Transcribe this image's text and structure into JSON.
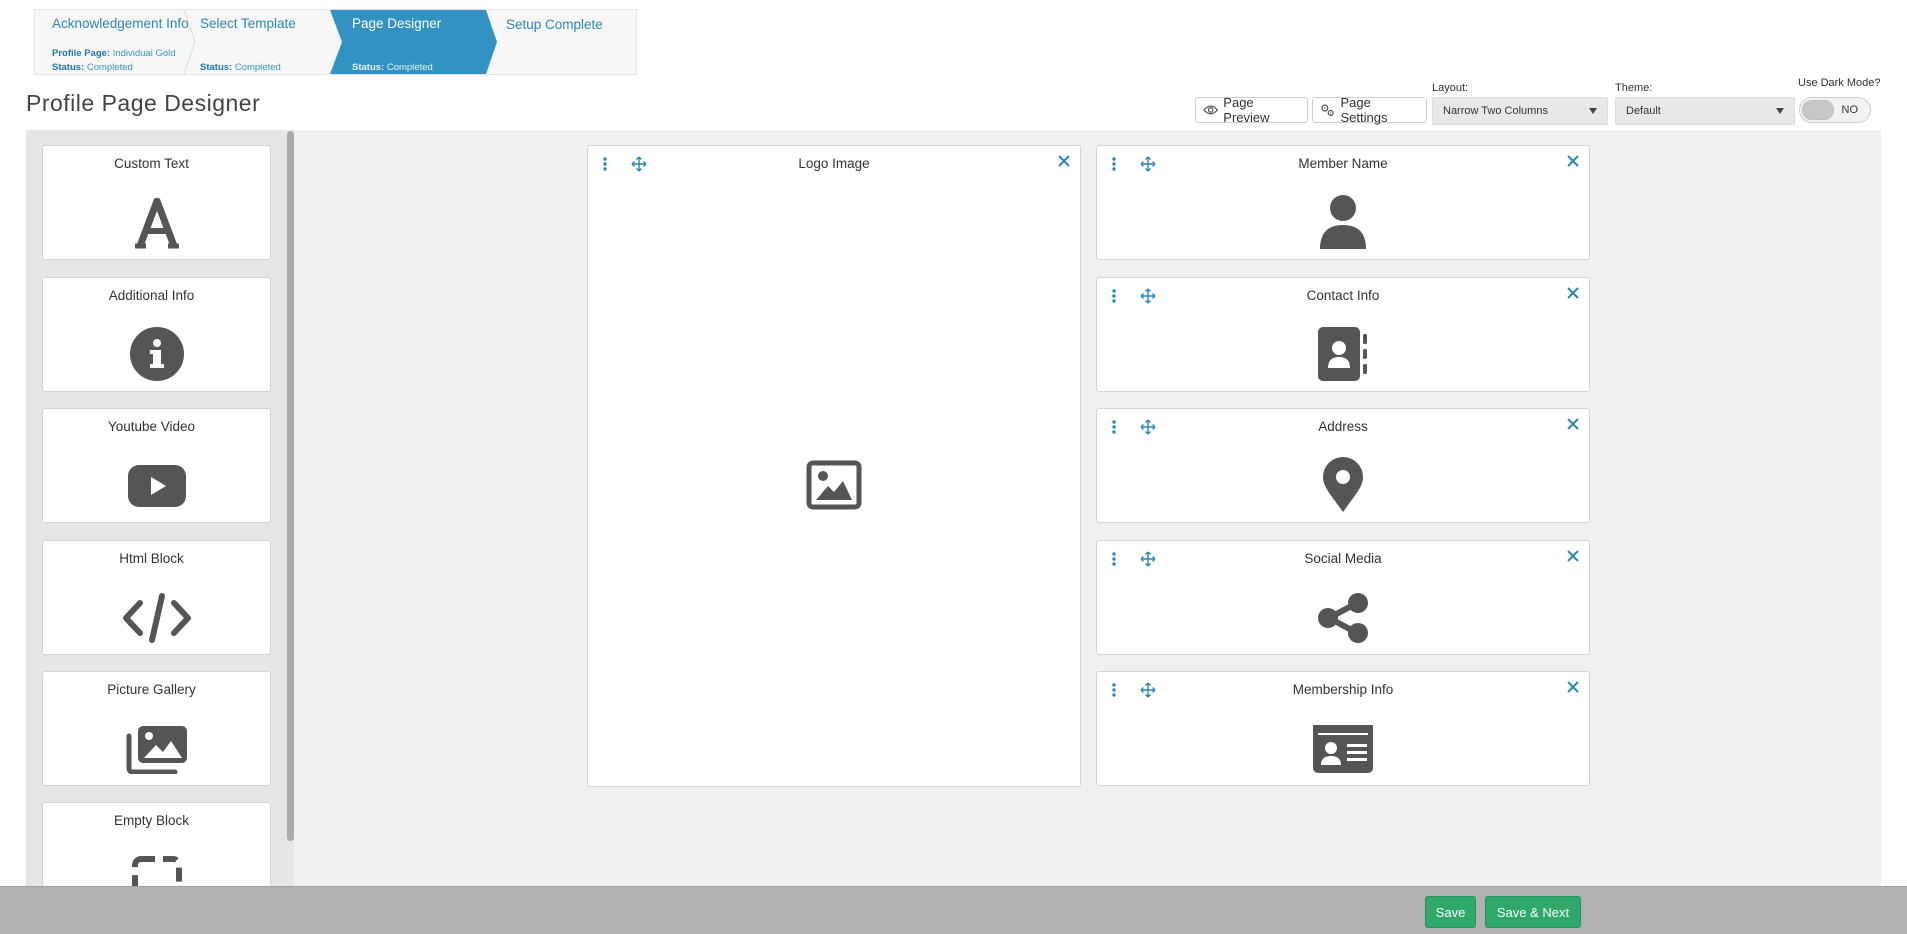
{
  "wizard": {
    "steps": [
      {
        "title": "Acknowledgement Info",
        "meta": [
          {
            "k": "Profile Page:",
            "v": "Individual Gold"
          },
          {
            "k": "Status:",
            "v": "Completed"
          }
        ]
      },
      {
        "title": "Select Template",
        "meta": [
          {
            "k": "Status:",
            "v": "Completed"
          }
        ]
      },
      {
        "title": "Page Designer",
        "meta": [
          {
            "k": "Status:",
            "v": "Completed"
          }
        ]
      },
      {
        "title": "Setup Complete",
        "meta": []
      }
    ],
    "active_step": "Page Designer"
  },
  "header": {
    "title": "Profile Page Designer",
    "page_preview": "Page Preview",
    "page_settings": "Page Settings",
    "layout_label": "Layout:",
    "layout_value": "Narrow Two Columns",
    "theme_label": "Theme:",
    "theme_value": "Default",
    "dark_mode_label": "Use Dark Mode?",
    "dark_mode_value": "NO"
  },
  "palette": {
    "items": [
      {
        "label": "Custom Text",
        "icon": "letter-a-icon"
      },
      {
        "label": "Additional Info",
        "icon": "info-circle-icon"
      },
      {
        "label": "Youtube Video",
        "icon": "youtube-icon"
      },
      {
        "label": "Html Block",
        "icon": "code-icon"
      },
      {
        "label": "Picture Gallery",
        "icon": "images-icon"
      },
      {
        "label": "Empty Block",
        "icon": "dashed-square-icon"
      }
    ]
  },
  "layout": {
    "left_column": [
      {
        "label": "Logo Image",
        "icon": "image-icon"
      }
    ],
    "right_column": [
      {
        "label": "Member Name",
        "icon": "user-icon"
      },
      {
        "label": "Contact Info",
        "icon": "address-book-icon"
      },
      {
        "label": "Address",
        "icon": "map-marker-icon"
      },
      {
        "label": "Social Media",
        "icon": "share-icon"
      },
      {
        "label": "Membership Info",
        "icon": "id-card-icon"
      }
    ]
  },
  "footer": {
    "save": "Save",
    "save_next": "Save & Next"
  },
  "colors": {
    "accent": "#2a88b8",
    "active_step": "#3293c2",
    "icon": "#555555",
    "save": "#2ea86b"
  }
}
